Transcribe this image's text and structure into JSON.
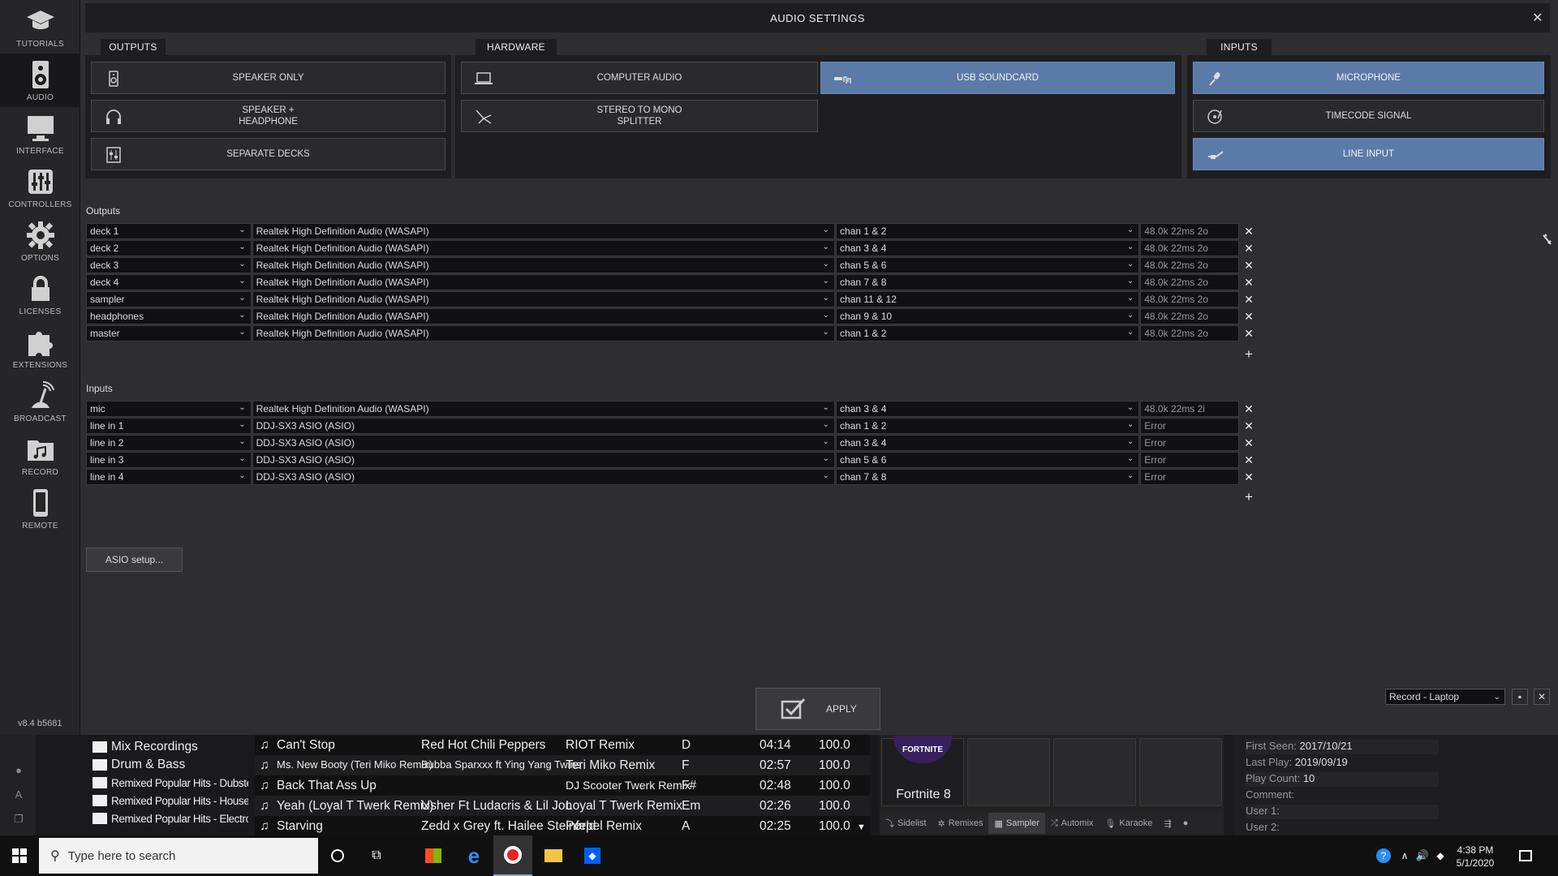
{
  "nav": {
    "items": [
      {
        "label": "TUTORIALS",
        "icon": "graduation-cap-icon"
      },
      {
        "label": "AUDIO",
        "icon": "speaker-icon"
      },
      {
        "label": "INTERFACE",
        "icon": "monitor-icon"
      },
      {
        "label": "CONTROLLERS",
        "icon": "sliders-icon"
      },
      {
        "label": "OPTIONS",
        "icon": "gear-icon"
      },
      {
        "label": "LICENSES",
        "icon": "lock-icon"
      },
      {
        "label": "EXTENSIONS",
        "icon": "puzzle-icon"
      },
      {
        "label": "BROADCAST",
        "icon": "broadcast-icon"
      },
      {
        "label": "RECORD",
        "icon": "music-folder-icon"
      },
      {
        "label": "REMOTE",
        "icon": "phone-icon"
      }
    ],
    "version": "v8.4 b5681"
  },
  "window": {
    "title": "AUDIO SETTINGS",
    "close": "✕"
  },
  "outputs_group": {
    "tab": "OUTPUTS",
    "buttons": [
      {
        "label": "SPEAKER ONLY",
        "icon": "speaker-icon"
      },
      {
        "label": "SPEAKER +\nHEADPHONE",
        "icon": "headphones-icon"
      },
      {
        "label": "SEPARATE DECKS",
        "icon": "mixer-icon"
      }
    ]
  },
  "hardware_group": {
    "tab": "HARDWARE",
    "buttons": [
      {
        "label": "COMPUTER AUDIO",
        "icon": "laptop-icon",
        "selected": false
      },
      {
        "label": "USB SOUNDCARD",
        "icon": "usb-icon",
        "selected": true
      },
      {
        "label": "STEREO TO MONO\nSPLITTER",
        "icon": "splitter-icon",
        "selected": false
      }
    ]
  },
  "inputs_group": {
    "tab": "INPUTS",
    "buttons": [
      {
        "label": "MICROPHONE",
        "icon": "microphone-icon",
        "selected": true
      },
      {
        "label": "TIMECODE SIGNAL",
        "icon": "turntable-icon",
        "selected": false
      },
      {
        "label": "LINE INPUT",
        "icon": "line-input-icon",
        "selected": true
      }
    ]
  },
  "outputs": {
    "label": "Outputs",
    "rows": [
      {
        "channel": "deck 1",
        "device": "Realtek High Definition Audio (WASAPI)",
        "chan": "chan 1 & 2",
        "info": "48.0k 22ms 2o"
      },
      {
        "channel": "deck 2",
        "device": "Realtek High Definition Audio (WASAPI)",
        "chan": "chan 3 & 4",
        "info": "48.0k 22ms 2o"
      },
      {
        "channel": "deck 3",
        "device": "Realtek High Definition Audio (WASAPI)",
        "chan": "chan 5 & 6",
        "info": "48.0k 22ms 2o"
      },
      {
        "channel": "deck 4",
        "device": "Realtek High Definition Audio (WASAPI)",
        "chan": "chan 7 & 8",
        "info": "48.0k 22ms 2o"
      },
      {
        "channel": "sampler",
        "device": "Realtek High Definition Audio (WASAPI)",
        "chan": "chan 11 & 12",
        "info": "48.0k 22ms 2o"
      },
      {
        "channel": "headphones",
        "device": "Realtek High Definition Audio (WASAPI)",
        "chan": "chan 9 & 10",
        "info": "48.0k 22ms 2o"
      },
      {
        "channel": "master",
        "device": "Realtek High Definition Audio (WASAPI)",
        "chan": "chan 1 & 2",
        "info": "48.0k 22ms 2o"
      }
    ]
  },
  "inputs": {
    "label": "Inputs",
    "rows": [
      {
        "channel": "mic",
        "device": "Realtek High Definition Audio (WASAPI)",
        "chan": "chan 3 & 4",
        "info": "48.0k 22ms 2i"
      },
      {
        "channel": "line in 1",
        "device": "DDJ-SX3 ASIO (ASIO)",
        "chan": "chan 1 & 2",
        "info": "Error"
      },
      {
        "channel": "line in 2",
        "device": "DDJ-SX3 ASIO (ASIO)",
        "chan": "chan 3 & 4",
        "info": "Error"
      },
      {
        "channel": "line in 3",
        "device": "DDJ-SX3 ASIO (ASIO)",
        "chan": "chan 5 & 6",
        "info": "Error"
      },
      {
        "channel": "line in 4",
        "device": "DDJ-SX3 ASIO (ASIO)",
        "chan": "chan 7 & 8",
        "info": "Error"
      }
    ]
  },
  "asio_button": "ASIO setup...",
  "apply_button": "APPLY",
  "profile": {
    "selected": "Record - Laptop"
  },
  "browser": {
    "folders": [
      {
        "name": "Mix Recordings",
        "small": false
      },
      {
        "name": "Drum & Bass",
        "small": false
      },
      {
        "name": "Remixed Popular Hits - Dubstep",
        "small": true
      },
      {
        "name": "Remixed Popular Hits - House",
        "small": true
      },
      {
        "name": "Remixed Popular Hits - Electro",
        "small": true
      }
    ],
    "tracks": [
      {
        "title": "Can't Stop",
        "artist": "Red Hot Chili Peppers",
        "remix": "RIOT Remix",
        "key": "D",
        "length": "04:14",
        "bpm": "100.0"
      },
      {
        "title": "Ms. New Booty (Teri Miko Remix)",
        "artist": "Bubba Sparxxx ft Ying Yang Twins",
        "remix": "Teri Miko Remix",
        "key": "F",
        "length": "02:57",
        "bpm": "100.0"
      },
      {
        "title": "Back That Ass Up",
        "artist": "",
        "remix": "DJ Scooter Twerk Remix",
        "key": "F#",
        "length": "02:48",
        "bpm": "100.0"
      },
      {
        "title": "Yeah (Loyal T Twerk Remix)",
        "artist": "Usher Ft Ludacris & Lil Jon",
        "remix": "Loyal T Twerk Remix",
        "key": "Em",
        "length": "02:26",
        "bpm": "100.0"
      },
      {
        "title": "Starving",
        "artist": "Zedd x Grey ft. Hailee Steinfeld",
        "remix": "Pørpel Remix",
        "key": "A",
        "length": "02:25",
        "bpm": "100.0"
      }
    ]
  },
  "sampler": {
    "pad1_label": "Fortnite 8",
    "pad1_logo": "FORTNITE",
    "tabs": [
      "Sidelist",
      "Remixes",
      "Sampler",
      "Automix",
      "Karaoke"
    ]
  },
  "track_info": {
    "first_seen_label": "First Seen:",
    "first_seen": "2017/10/21",
    "last_play_label": "Last Play:",
    "last_play": "2019/09/19",
    "play_count_label": "Play Count:",
    "play_count": "10",
    "comment_label": "Comment:",
    "user1_label": "User 1:",
    "user2_label": "User 2:"
  },
  "taskbar": {
    "search_placeholder": "Type here to search",
    "time": "4:38 PM",
    "date": "5/1/2020"
  }
}
